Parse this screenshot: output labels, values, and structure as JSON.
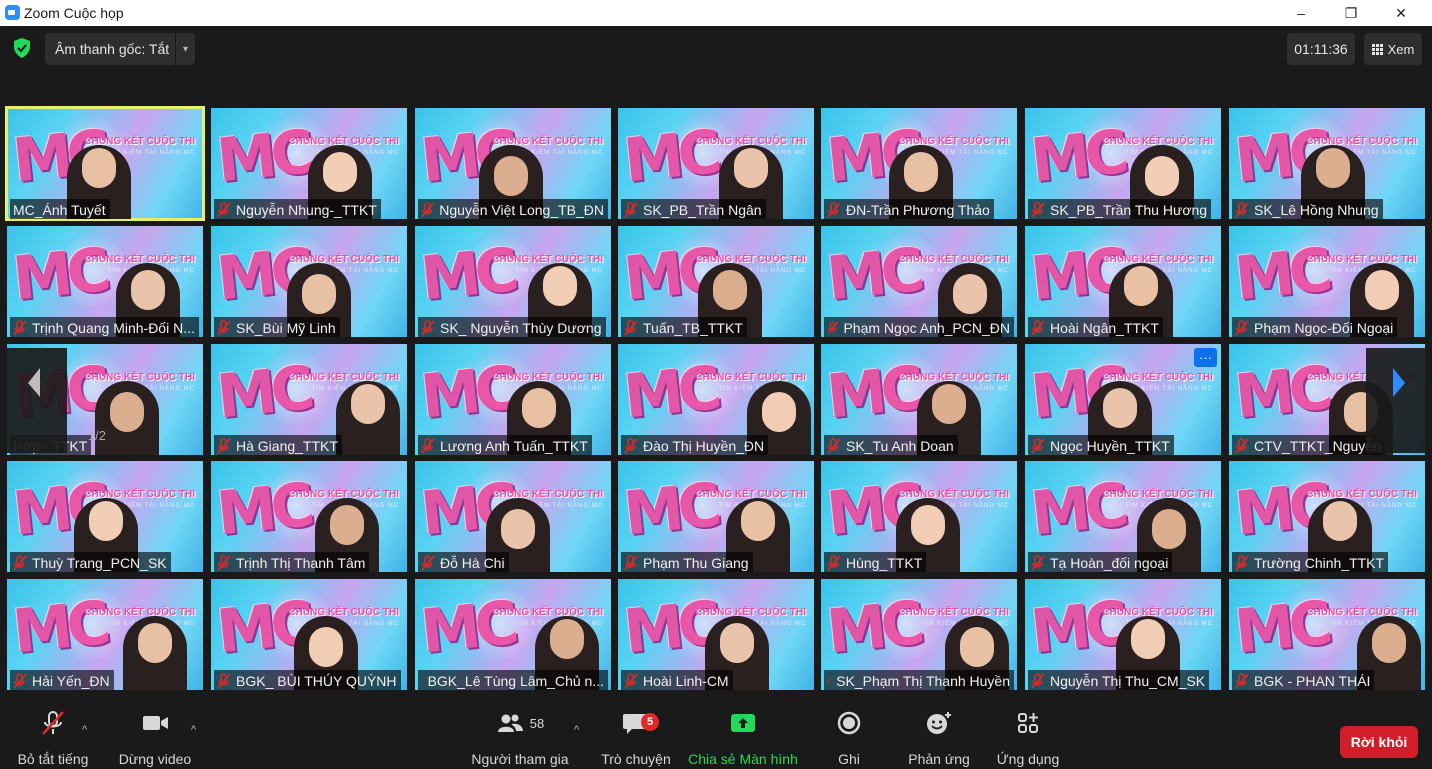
{
  "window": {
    "title": "Zoom Cuộc họp",
    "minimize": "–",
    "maximize": "❐",
    "close": "✕"
  },
  "top": {
    "audio_label": "Âm thanh gốc: Tắt",
    "caret": "▾",
    "timer": "01:11:36",
    "view_label": "Xem"
  },
  "gallery": {
    "page": "1/2",
    "active_index": 0,
    "tiles": [
      {
        "name": "MC_Ánh Tuyết",
        "muted": false
      },
      {
        "name": "Nguyễn Nhung-_TTKT",
        "muted": true
      },
      {
        "name": "Nguyễn Việt Long_TB_ĐN",
        "muted": true
      },
      {
        "name": "SK_PB_Trần Ngân",
        "muted": true
      },
      {
        "name": "ĐN-Trần Phương Thảo",
        "muted": true
      },
      {
        "name": "SK_PB_Trần Thu Hương",
        "muted": true
      },
      {
        "name": "SK_Lê Hồng Nhung",
        "muted": true
      },
      {
        "name": "Trịnh Quang Minh-Đối N...",
        "muted": true
      },
      {
        "name": "SK_Bùi Mỹ Linh",
        "muted": true
      },
      {
        "name": "SK_ Nguyễn Thùy Dương",
        "muted": true
      },
      {
        "name": "Tuấn_TB_TTKT",
        "muted": true
      },
      {
        "name": "Phạm Ngọc Anh_PCN_ĐN",
        "muted": true
      },
      {
        "name": "Hoài Ngân_TTKT",
        "muted": true
      },
      {
        "name": "Phạm Ngọc-Đối Ngoại",
        "muted": true
      },
      {
        "name": "Hợp - TTKT",
        "muted": false
      },
      {
        "name": "Hà Giang_TTKT",
        "muted": true
      },
      {
        "name": "Lương Anh Tuấn_TTKT",
        "muted": true
      },
      {
        "name": "Đào Thị Huyền_ĐN",
        "muted": true
      },
      {
        "name": "SK_Tu Anh Doan",
        "muted": true
      },
      {
        "name": "Ngọc Huyền_TTKT",
        "muted": true
      },
      {
        "name": "CTV_TTKT_Nguyễn",
        "muted": true
      },
      {
        "name": "Thuỳ Trang_PCN_SK",
        "muted": true
      },
      {
        "name": "Trịnh Thị Thanh Tâm",
        "muted": true
      },
      {
        "name": "Đỗ Hà Chi",
        "muted": true
      },
      {
        "name": "Phạm Thu Giang",
        "muted": true
      },
      {
        "name": "Hùng_TTKT",
        "muted": true
      },
      {
        "name": "Tạ Hoàn_đối ngoại",
        "muted": true
      },
      {
        "name": "Trường Chinh_TTKT",
        "muted": true
      },
      {
        "name": "Hải Yến_ĐN",
        "muted": true
      },
      {
        "name": "BGK_ BÙI THÚY QUỲNH",
        "muted": true
      },
      {
        "name": "BGK_Lê Tùng Lâm_Chủ n...",
        "muted": true
      },
      {
        "name": "Hoài Linh-CM",
        "muted": true
      },
      {
        "name": "SK_Phạm Thị Thanh Huyền",
        "muted": true
      },
      {
        "name": "Nguyễn Thị Thu_CM_SK",
        "muted": true
      },
      {
        "name": "BGK - PHAN THÁI",
        "muted": true
      }
    ],
    "banner_title": "CHUNG KẾT CUỘC THI",
    "banner_sub": "TÌM KIẾM TÀI NĂNG MC",
    "logo_text": "MC",
    "more_label": "···"
  },
  "toolbar": {
    "mute_label": "Bỏ tắt tiếng",
    "video_label": "Dừng video",
    "participants_label": "Người tham gia",
    "participants_count": "58",
    "chat_label": "Trò chuyện",
    "chat_badge": "5",
    "share_label": "Chia sẻ Màn hình",
    "record_label": "Ghi",
    "reactions_label": "Phản ứng",
    "apps_label": "Ứng dụng",
    "leave_label": "Rời khỏi",
    "caret": "^"
  },
  "colors": {
    "accent_green": "#23d959",
    "leave_red": "#d21e2a",
    "badge_red": "#e02828",
    "active_outline": "#e4f06c",
    "more_blue": "#0e71eb"
  }
}
